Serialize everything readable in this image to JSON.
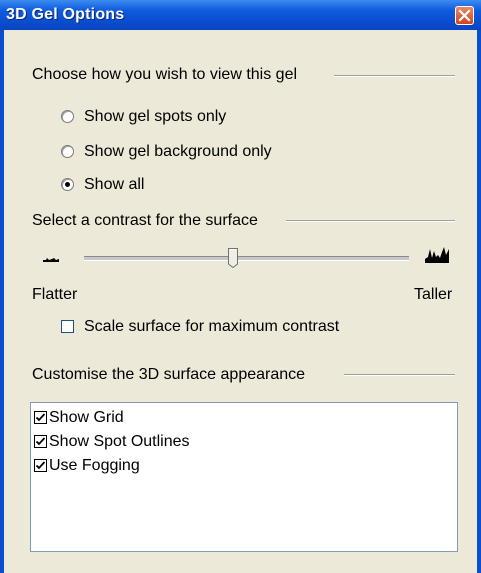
{
  "window": {
    "title": "3D Gel Options"
  },
  "view_group": {
    "label": "Choose how you wish to view this gel",
    "options": [
      {
        "label": "Show gel spots only",
        "selected": false
      },
      {
        "label": "Show gel background only",
        "selected": false
      },
      {
        "label": "Show all",
        "selected": true
      }
    ]
  },
  "contrast_group": {
    "label": "Select a contrast for the surface",
    "slider_value_fraction": 0.46,
    "min_label": "Flatter",
    "max_label": "Taller",
    "scale_checkbox": {
      "label": "Scale surface for maximum contrast",
      "checked": false
    }
  },
  "appearance_group": {
    "label": "Customise the 3D surface appearance",
    "items": [
      {
        "label": "Show Grid",
        "checked": true
      },
      {
        "label": "Show Spot Outlines",
        "checked": true
      },
      {
        "label": "Use Fogging",
        "checked": true
      }
    ]
  },
  "colors": {
    "titlebar": "#0a4ed0",
    "dialog_bg": "#ece9d8",
    "close_button": "#d3431b"
  },
  "icons": {
    "close": "close-icon",
    "flatter": "flat-surface-icon",
    "taller": "tall-surface-icon"
  }
}
